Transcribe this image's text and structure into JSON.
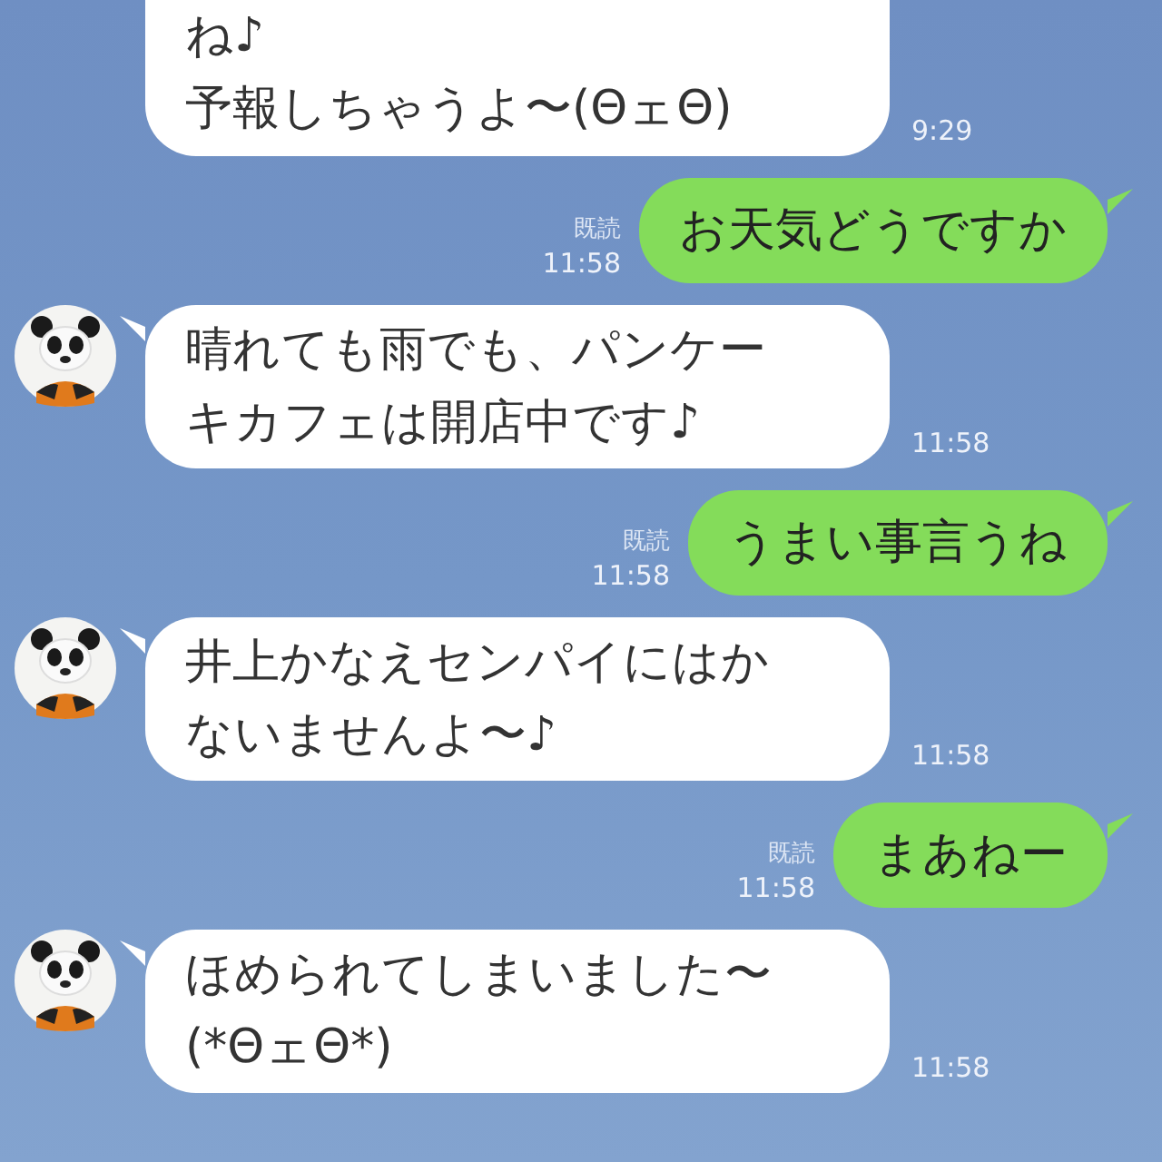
{
  "messages": [
    {
      "kind": "in",
      "avatar": false,
      "lines": [
        "ね♪",
        "予報しちゃうよ〜(ΘェΘ)"
      ],
      "time": "9:29"
    },
    {
      "kind": "out",
      "lines": [
        "お天気どうですか"
      ],
      "read": "既読",
      "time": "11:58"
    },
    {
      "kind": "in",
      "avatar": true,
      "lines": [
        "晴れても雨でも、パンケー",
        "キカフェは開店中です♪"
      ],
      "time": "11:58"
    },
    {
      "kind": "out",
      "lines": [
        "うまい事言うね"
      ],
      "read": "既読",
      "time": "11:58"
    },
    {
      "kind": "in",
      "avatar": true,
      "lines": [
        "井上かなえセンパイにはか",
        "ないませんよ〜♪"
      ],
      "time": "11:58"
    },
    {
      "kind": "out",
      "lines": [
        "まあねー"
      ],
      "read": "既読",
      "time": "11:58"
    },
    {
      "kind": "in",
      "avatar": true,
      "lines": [
        "ほめられてしまいました〜",
        "(*ΘェΘ*)"
      ],
      "time": "11:58"
    }
  ]
}
